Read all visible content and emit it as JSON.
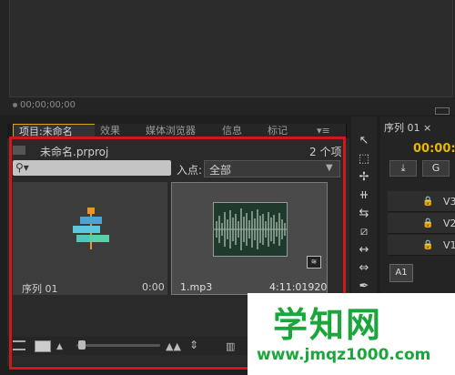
{
  "monitor": {
    "timecode": "00;00;00;00"
  },
  "project_panel": {
    "tabs": [
      {
        "label": "项目:未命名"
      },
      {
        "label": "效果"
      },
      {
        "label": "媒体浏览器"
      },
      {
        "label": "信息"
      },
      {
        "label": "标记"
      },
      {
        "label": "▾≡"
      }
    ],
    "project_name": "未命名.prproj",
    "item_count": "2 个项",
    "search_icon": "⚲▾",
    "in_point_label": "入点:",
    "in_point_value": "全部",
    "items": [
      {
        "name": "序列 01",
        "duration": "0:00",
        "icon": "sequence-icon"
      },
      {
        "name": "1.mp3",
        "duration": "4:11:01920",
        "icon": "audio-waveform-icon"
      }
    ],
    "audio_badge": "≋"
  },
  "timeline": {
    "tab_label": "序列 01 ×",
    "timecode": "00:00:0",
    "tracks": [
      "V3",
      "V2",
      "V1"
    ],
    "audio_track": "A1"
  },
  "watermark": {
    "text": "学知网",
    "url": "www.jmqz1000.com"
  },
  "colors": {
    "highlight": "#d01818",
    "accent": "#e8b800",
    "watermark": "#1aa63a"
  }
}
